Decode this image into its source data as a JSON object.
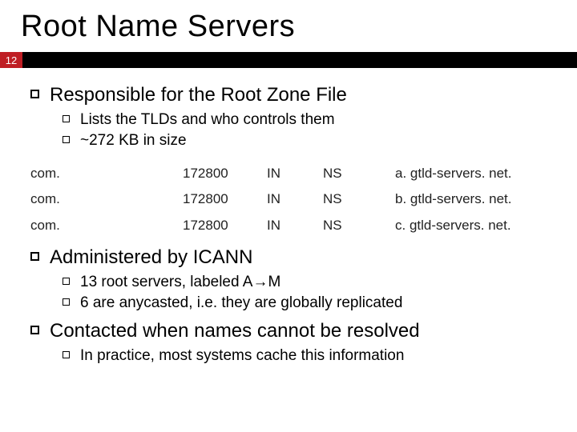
{
  "title": "Root Name Servers",
  "page_number": "12",
  "bullets": {
    "b1": {
      "text": "Responsible for the Root Zone File",
      "sub": {
        "s1": "Lists the TLDs and who controls them",
        "s2": "~272 KB in size"
      }
    },
    "b2": {
      "text": "Administered by ICANN",
      "sub": {
        "s1": "13 root servers, labeled A→M",
        "s2": "6 are anycasted, i.e. they are globally replicated"
      }
    },
    "b3": {
      "text": "Contacted when names cannot be resolved",
      "sub": {
        "s1": "In practice, most systems cache this information"
      }
    }
  },
  "table": {
    "rows": [
      {
        "c1": "com.",
        "c2": "172800",
        "c3": "IN",
        "c4": "NS",
        "c5": "a. gtld-servers. net."
      },
      {
        "c1": "com.",
        "c2": "172800",
        "c3": "IN",
        "c4": "NS",
        "c5": "b. gtld-servers. net."
      },
      {
        "c1": "com.",
        "c2": "172800",
        "c3": "IN",
        "c4": "NS",
        "c5": "c. gtld-servers. net."
      }
    ]
  }
}
